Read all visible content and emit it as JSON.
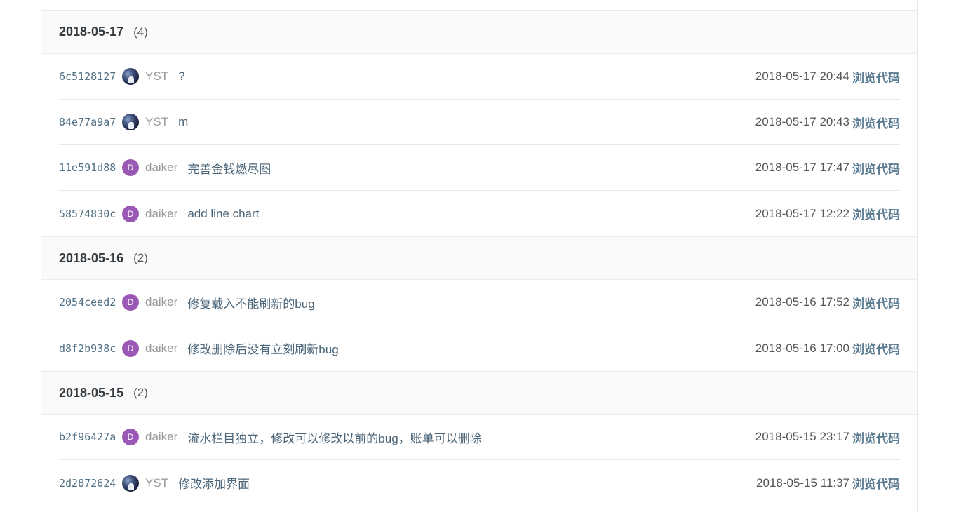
{
  "groups": [
    {
      "date": "2018-05-17",
      "count": "(4)",
      "commits": [
        {
          "sha": "6c5128127",
          "avatar": "image",
          "avatar_letter": "",
          "author": "YST",
          "message": "?",
          "time": "2018-05-17 20:44",
          "action": "浏览代码"
        },
        {
          "sha": "84e77a9a7",
          "avatar": "image",
          "avatar_letter": "",
          "author": "YST",
          "message": "m",
          "time": "2018-05-17 20:43",
          "action": "浏览代码"
        },
        {
          "sha": "11e591d88",
          "avatar": "letter",
          "avatar_letter": "D",
          "author": "daiker",
          "message": "完善金钱燃尽图",
          "time": "2018-05-17 17:47",
          "action": "浏览代码"
        },
        {
          "sha": "58574830c",
          "avatar": "letter",
          "avatar_letter": "D",
          "author": "daiker",
          "message": "add line chart",
          "time": "2018-05-17 12:22",
          "action": "浏览代码"
        }
      ]
    },
    {
      "date": "2018-05-16",
      "count": "(2)",
      "commits": [
        {
          "sha": "2054ceed2",
          "avatar": "letter",
          "avatar_letter": "D",
          "author": "daiker",
          "message": "修复载入不能刷新的bug",
          "time": "2018-05-16 17:52",
          "action": "浏览代码"
        },
        {
          "sha": "d8f2b938c",
          "avatar": "letter",
          "avatar_letter": "D",
          "author": "daiker",
          "message": "修改删除后没有立刻刷新bug",
          "time": "2018-05-16 17:00",
          "action": "浏览代码"
        }
      ]
    },
    {
      "date": "2018-05-15",
      "count": "(2)",
      "commits": [
        {
          "sha": "b2f96427a",
          "avatar": "letter",
          "avatar_letter": "D",
          "author": "daiker",
          "message": "流水栏目独立，修改可以修改以前的bug，账单可以删除",
          "time": "2018-05-15 23:17",
          "action": "浏览代码"
        },
        {
          "sha": "2d2872624",
          "avatar": "image",
          "avatar_letter": "",
          "author": "YST",
          "message": "修改添加界面",
          "time": "2018-05-15 11:37",
          "action": "浏览代码"
        }
      ]
    }
  ],
  "colors": {
    "letter_avatar": "#9b59b6",
    "sha": "#4f6f84",
    "link": "#5b7c91"
  }
}
